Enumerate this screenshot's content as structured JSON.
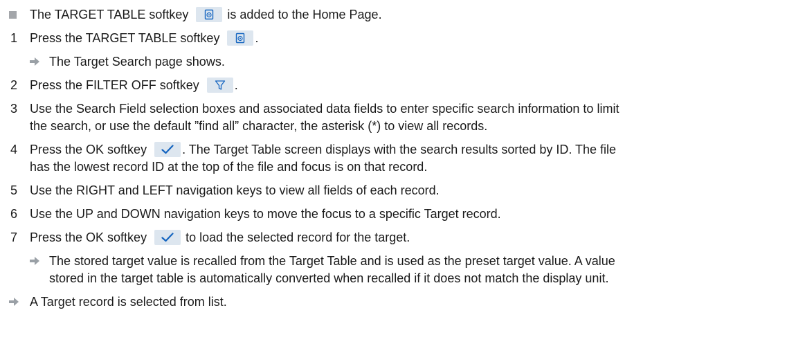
{
  "lines": {
    "l0": {
      "pre": "The TARGET TABLE softkey ",
      "post": " is added to the Home Page."
    },
    "s1": {
      "num": "1",
      "pre": "Press the TARGET TABLE softkey ",
      "post": "."
    },
    "r1": {
      "text": "The Target Search page shows."
    },
    "s2": {
      "num": "2",
      "pre": "Press the FILTER OFF softkey ",
      "post": "."
    },
    "s3": {
      "num": "3",
      "text1": "Use the Search Field selection boxes and associated data fields to enter specific search information to limit",
      "text2": "the search, or use the default ”find all” character, the asterisk (*) to view all records."
    },
    "s4": {
      "num": "4",
      "pre": "Press the OK softkey ",
      "post": ". The Target Table screen displays with the search results sorted by ID. The file",
      "text2": "has the lowest record ID at the top of the file and focus is on that record."
    },
    "s5": {
      "num": "5",
      "text": "Use the RIGHT and LEFT navigation keys to view all fields of each record."
    },
    "s6": {
      "num": "6",
      "text": "Use the UP and DOWN navigation keys to move the focus to a specific Target record."
    },
    "s7": {
      "num": "7",
      "pre": "Press the OK softkey ",
      "post": " to load the selected record for the target."
    },
    "r7": {
      "text1": "The stored target value is recalled from the Target Table and is used as the preset target value. A value",
      "text2": "stored in the target table is automatically converted when recalled if it does not match the display unit."
    },
    "final": {
      "text": "A Target record is selected from list."
    }
  },
  "icons": {
    "target_table": "target-table-softkey-icon",
    "filter_off": "filter-off-softkey-icon",
    "ok": "ok-checkmark-softkey-icon",
    "result_arrow": "result-arrow-icon",
    "bullet": "bullet-square-icon"
  },
  "colors": {
    "key_background": "#dde6ef",
    "icon_blue": "#1565c0",
    "bullet_gray": "#a3a6aa",
    "arrow_gray": "#9aa0a6"
  }
}
